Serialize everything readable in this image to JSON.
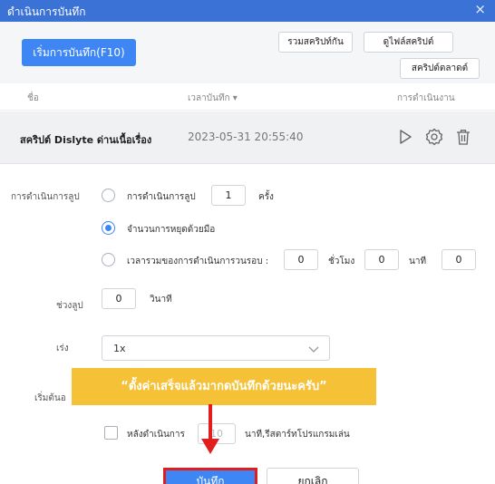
{
  "window": {
    "title": "ดำเนินการบันทึก",
    "close_glyph": "×"
  },
  "toolbar": {
    "record_label": "เริ่มการบันทึก(F10)",
    "merge_label": "รวมสคริปท์กัน",
    "view_file_label": "ดูไฟล์สคริปต์",
    "market_label": "สคริปต์ตลาดต์"
  },
  "table": {
    "headers": {
      "name": "ชื่อ",
      "time": "เวลาบันทึก ▾",
      "action": "การดำเนินงาน"
    },
    "rows": [
      {
        "name": "สคริปต์ Dislyte ด่านเนื้อเรื่อง",
        "time": "2023-05-31 20:55:40"
      }
    ]
  },
  "settings": {
    "loop_label": "การดำเนินการลูป",
    "opt_count_label": "การดำเนินการลูป",
    "opt_count_value": "1",
    "opt_count_unit": "ครั้ง",
    "opt_manual_label": "จำนวนการหยุดด้วยมือ",
    "opt_time_label": "เวลารวมของการดำเนินการวนรอบ :",
    "hours_value": "0",
    "hours_unit": "ชั่วโมง",
    "minutes_value": "0",
    "minutes_unit": "นาที",
    "seconds_value": "0",
    "interval_label": "ช่วงลูป",
    "interval_value": "0",
    "interval_unit": "วินาที",
    "speed_label": "เร่ง",
    "speed_value": "1x",
    "start_label": "เริ่มต้นอ",
    "after_label": "หลังดำเนินการ",
    "after_value": "10",
    "after_unit": "นาที,รีสตาร์ทโปรแกรมเล่น",
    "selected_option": "manual"
  },
  "annotation": {
    "text": "“ตั้งค่าเสร็จแล้วมากดบันทึกด้วยนะครับ”",
    "color": "#f5c137"
  },
  "footer": {
    "save_label": "บันทึก",
    "cancel_label": "ยกเลิก"
  },
  "colors": {
    "title_bar": "#3a72d6",
    "accent": "#3f86f5",
    "highlight": "#e11d1d"
  }
}
